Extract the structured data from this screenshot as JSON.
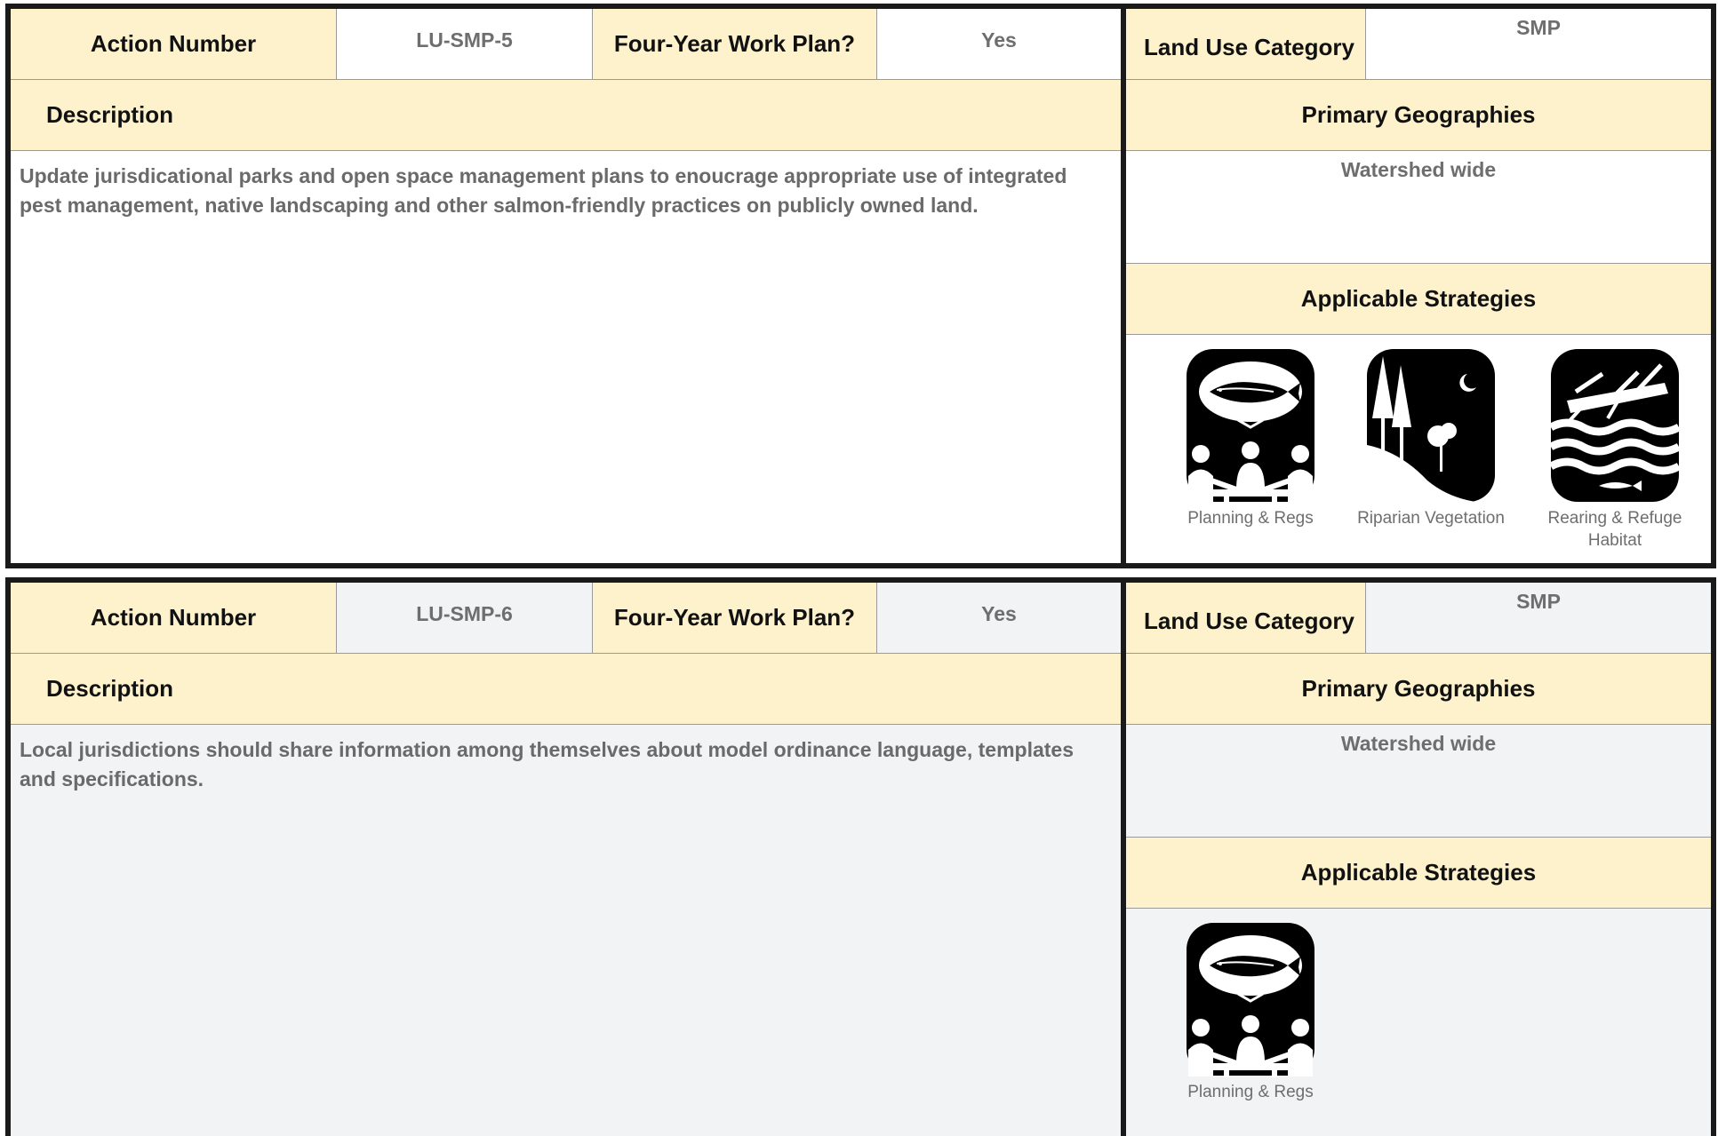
{
  "cards": [
    {
      "action_number_label": "Action Number",
      "action_number": "LU-SMP-5",
      "work_plan_label": "Four-Year Work Plan?",
      "work_plan": "Yes",
      "land_use_label": "Land Use Category",
      "land_use": "SMP",
      "description_label": "Description",
      "description": "Update jurisdicational parks and open space management plans to enoucrage appropriate use of integrated pest management, native landscaping and other salmon-friendly practices on publicly owned land.",
      "geographies_label": "Primary Geographies",
      "geographies": "Watershed wide",
      "strategies_label": "Applicable Strategies",
      "strategies": [
        {
          "label": "Planning & Regs",
          "icon": "planning-regs-icon"
        },
        {
          "label": "Riparian Vegetation",
          "icon": "riparian-vegetation-icon"
        },
        {
          "label": "Rearing & Refuge Habitat",
          "icon": "rearing-refuge-habitat-icon"
        }
      ]
    },
    {
      "action_number_label": "Action Number",
      "action_number": "LU-SMP-6",
      "work_plan_label": "Four-Year Work Plan?",
      "work_plan": "Yes",
      "land_use_label": "Land Use Category",
      "land_use": "SMP",
      "description_label": "Description",
      "description": "Local jurisdictions should share information among themselves about model ordinance language, templates and specifications.",
      "geographies_label": "Primary Geographies",
      "geographies": "Watershed wide",
      "strategies_label": "Applicable Strategies",
      "strategies": [
        {
          "label": "Planning & Regs",
          "icon": "planning-regs-icon"
        }
      ]
    }
  ]
}
